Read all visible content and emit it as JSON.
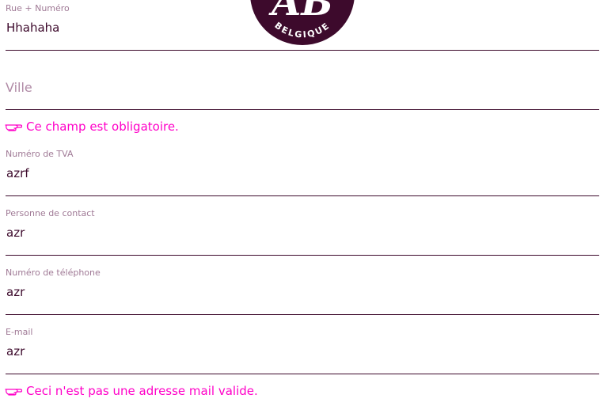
{
  "colors": {
    "brand": "#3d0a2c",
    "label": "#a07a96",
    "placeholder": "#b08aa6",
    "error": "#ff00c8"
  },
  "logo": {
    "mark": "AB",
    "ring_text": "BELGIQUE"
  },
  "form": {
    "street": {
      "label": "Rue + Numéro",
      "value": "Hhahaha"
    },
    "city": {
      "placeholder": "Ville",
      "error": "Ce champ est obligatoire."
    },
    "vat": {
      "label": "Numéro de TVA",
      "value": "azrf"
    },
    "contact": {
      "label": "Personne de contact",
      "value": "azr"
    },
    "phone": {
      "label": "Numéro de téléphone",
      "value": "azr"
    },
    "email": {
      "label": "E-mail",
      "value": "azr",
      "error": "Ceci n'est pas une adresse mail valide."
    }
  },
  "icons": {
    "error_icon": "pointing-hand-icon"
  }
}
